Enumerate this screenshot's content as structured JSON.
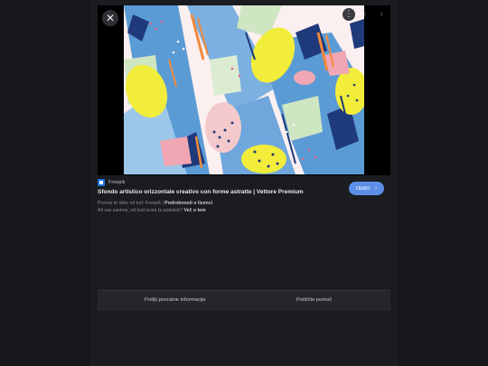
{
  "viewer": {
    "close_icon": "close-icon",
    "more_icon": "more-vert-icon",
    "prev_icon": "chevron-left-icon",
    "next_icon": "chevron-right-icon"
  },
  "image": {
    "source_name": "Freepik",
    "title": "Sfondo artistico orizzontale creativo con forme astratte | Vettore Premium",
    "license_prefix": "Prenos te slike od tod: Freepik | ",
    "license_link": "Podrobnosti o licenci",
    "similar_prefix": "Ali vas zanima, od kod izvira ta podatek? ",
    "similar_link": "Več o tem",
    "visit_label": "Obišči"
  },
  "footer": {
    "feedback_label": "Pošlji povratne informacije",
    "help_label": "Poiščite pomoč"
  },
  "colors": {
    "background": "#16171a",
    "accent": "#5e8fe8",
    "art_blue": "#5b9bd5",
    "art_navy": "#1f3a7a",
    "art_yellow": "#f2ec3a",
    "art_pink": "#f4c9cc",
    "art_green": "#cfe6c3",
    "art_orange": "#f08a3c"
  }
}
